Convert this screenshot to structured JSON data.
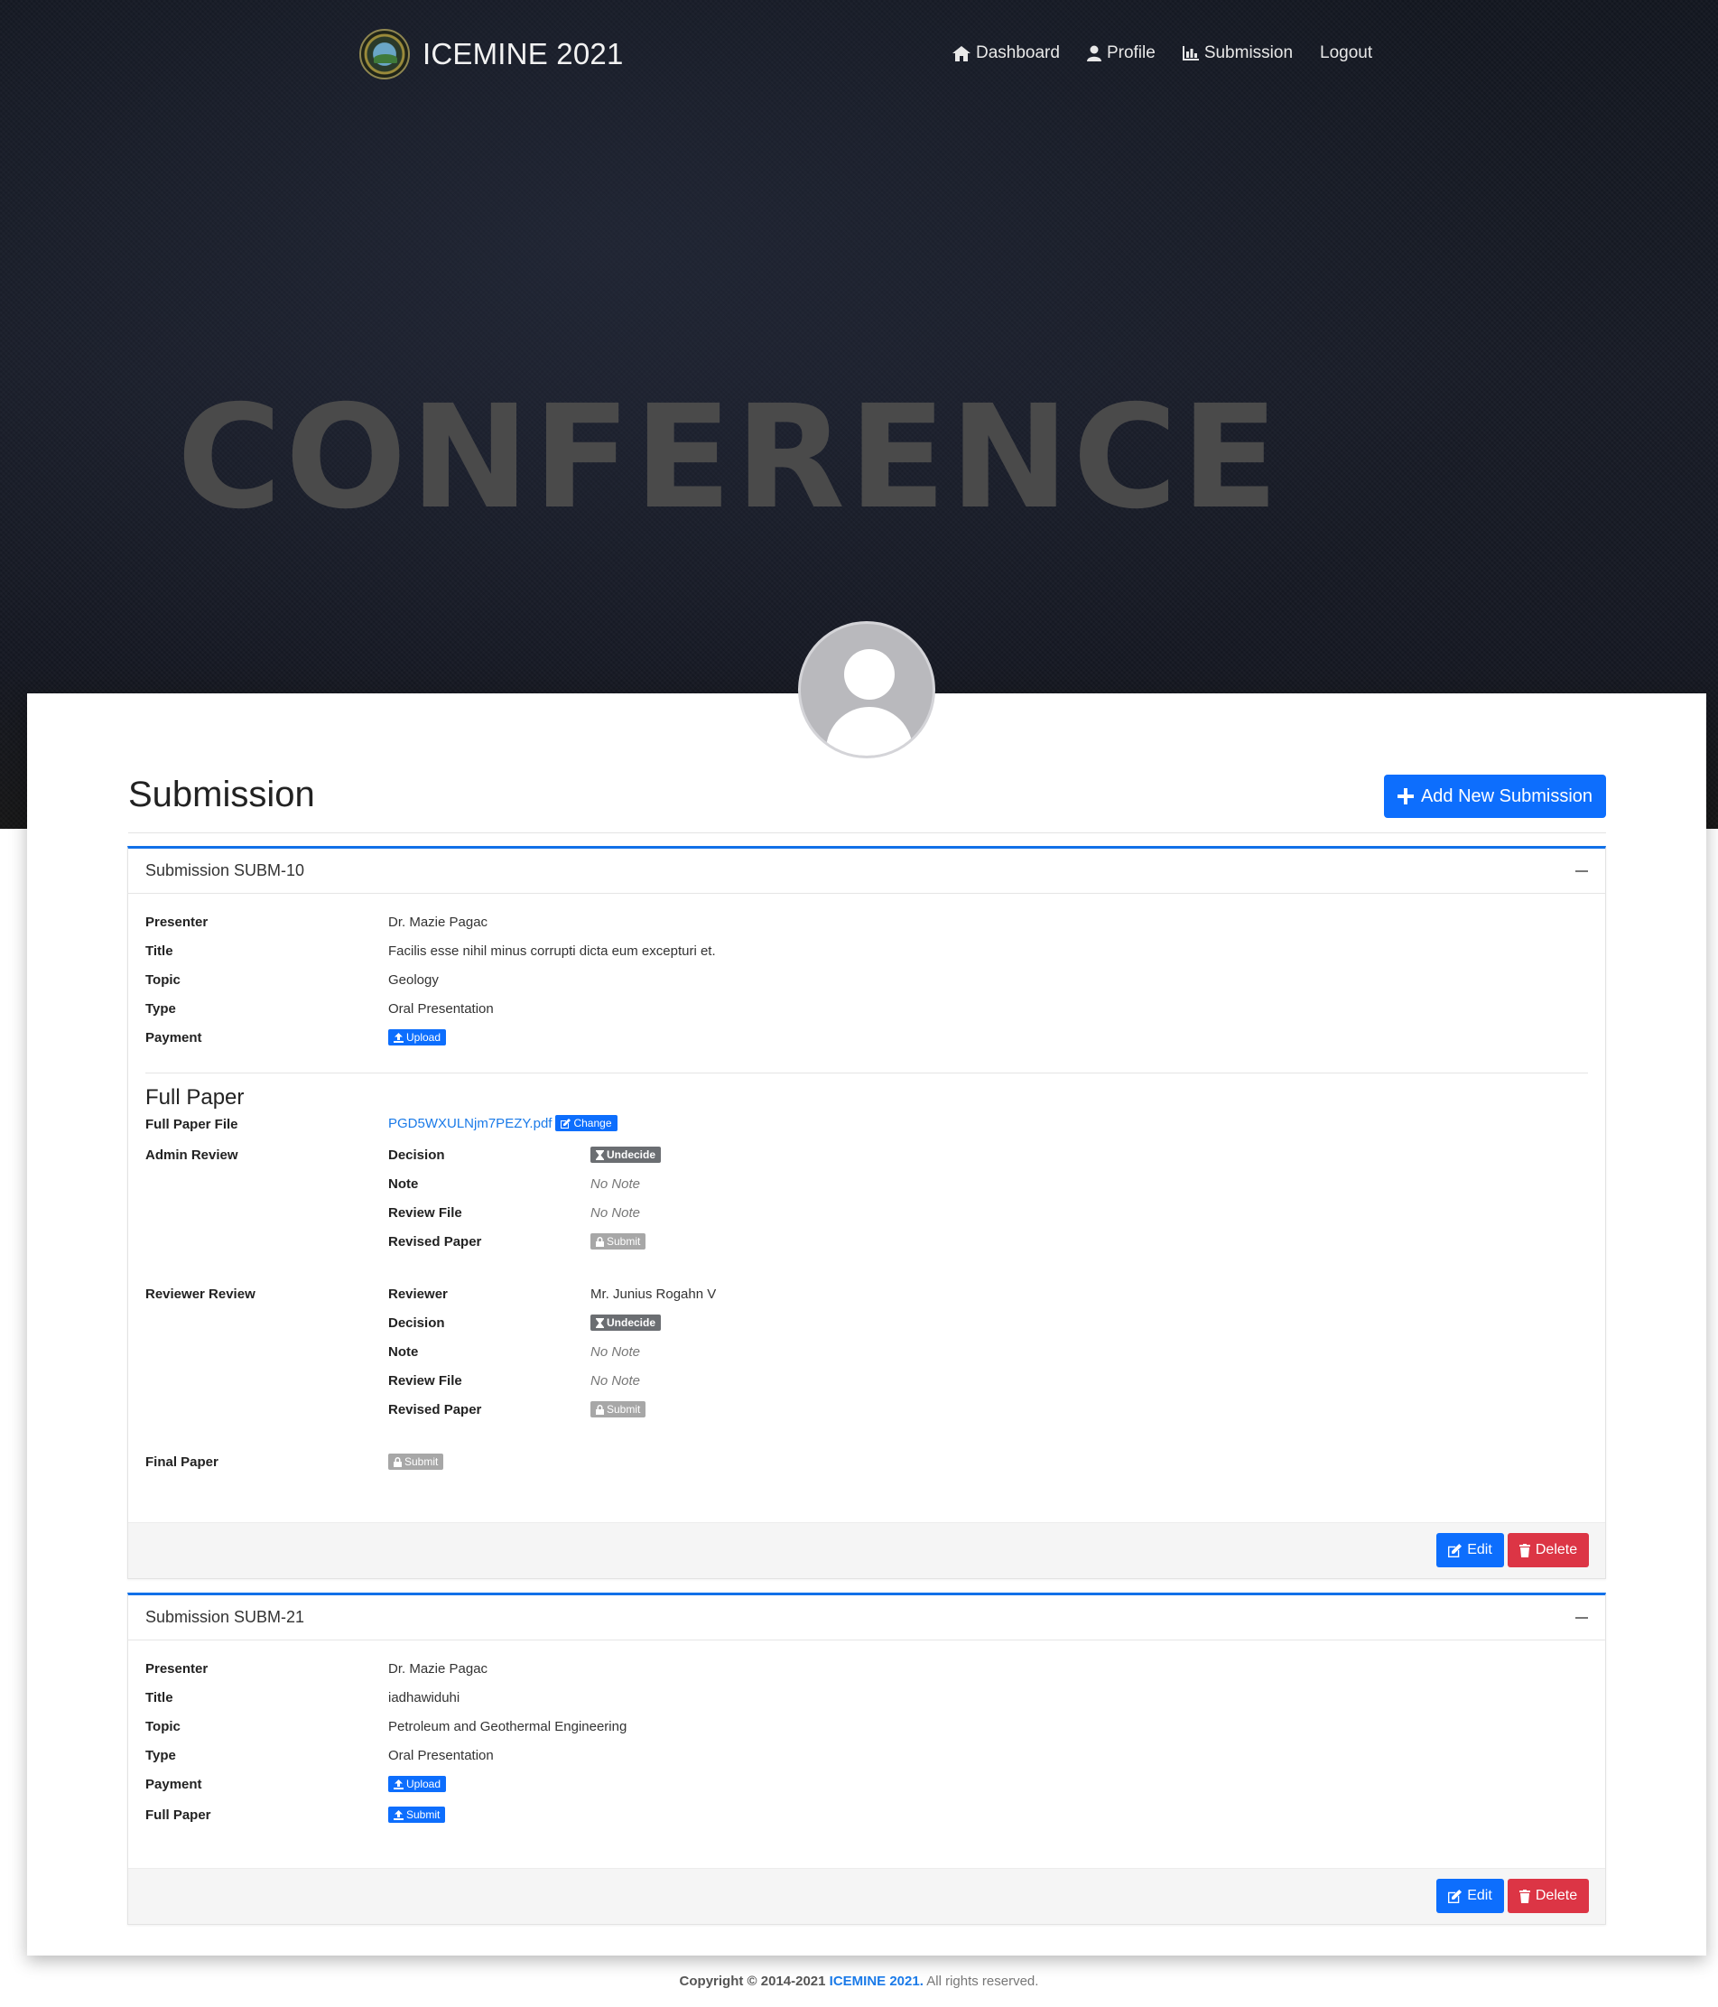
{
  "brand": {
    "name": "ICEMINE 2021"
  },
  "nav": {
    "dashboard": "Dashboard",
    "profile": "Profile",
    "submission": "Submission",
    "logout": "Logout"
  },
  "hero": {
    "word": "CONFERENCE"
  },
  "page": {
    "title": "Submission",
    "add_button": "Add New Submission"
  },
  "labels": {
    "presenter": "Presenter",
    "title": "Title",
    "topic": "Topic",
    "type": "Type",
    "payment": "Payment",
    "full_paper_section": "Full Paper",
    "full_paper_file": "Full Paper File",
    "admin_review": "Admin Review",
    "reviewer_review": "Reviewer Review",
    "decision": "Decision",
    "note": "Note",
    "review_file": "Review File",
    "revised_paper": "Revised Paper",
    "reviewer": "Reviewer",
    "final_paper": "Final Paper",
    "full_paper": "Full Paper"
  },
  "buttons": {
    "upload": "Upload",
    "change": "Change",
    "submit": "Submit",
    "undecide": "Undecide",
    "edit": "Edit",
    "delete": "Delete"
  },
  "submissions": [
    {
      "header": "Submission SUBM-10",
      "presenter": "Dr. Mazie Pagac",
      "title": "Facilis esse nihil minus corrupti dicta eum excepturi et.",
      "topic": "Geology",
      "type": "Oral Presentation",
      "full_paper_file": "PGD5WXULNjm7PEZY.pdf",
      "admin_note": "No Note",
      "admin_review_file": "No Note",
      "reviewer_name": "Mr. Junius Rogahn V",
      "reviewer_note": "No Note",
      "reviewer_review_file": "No Note"
    },
    {
      "header": "Submission SUBM-21",
      "presenter": "Dr. Mazie Pagac",
      "title": "iadhawiduhi",
      "topic": "Petroleum and Geothermal Engineering",
      "type": "Oral Presentation"
    }
  ],
  "footer": {
    "copyright": "Copyright © 2014-2021",
    "brand": "ICEMINE 2021.",
    "rights": "All rights reserved."
  },
  "colors": {
    "primary": "#0d6efd",
    "danger": "#dc3545",
    "panel_accent": "#1170e8",
    "badge_gray": "#a7a7a7",
    "badge_dark": "#6b6e72"
  }
}
